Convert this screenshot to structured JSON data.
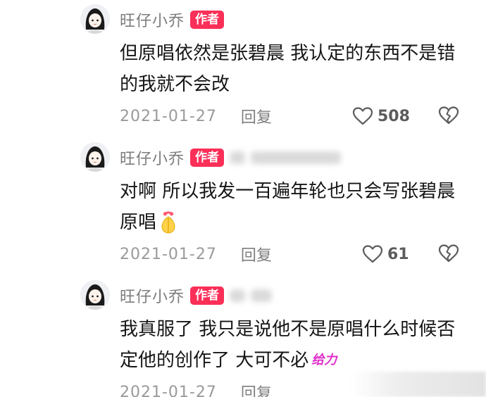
{
  "comments": [
    {
      "author": "旺仔小乔",
      "badge": "作者",
      "text": "但原唱依然是张碧晨 我认定的东西不是错的我就不会改",
      "date": "2021-01-27",
      "reply_label": "回复",
      "likes": "508"
    },
    {
      "author": "旺仔小乔",
      "badge": "作者",
      "text": "对啊 所以我发一百遍年轮也只会写张碧晨原唱",
      "date": "2021-01-27",
      "reply_label": "回复",
      "likes": "61"
    },
    {
      "author": "旺仔小乔",
      "badge": "作者",
      "text": "我真服了 我只是说他不是原唱什么时候否定他的创作了 大可不必",
      "sticker_text": "给力",
      "date": "2021-01-27",
      "reply_label": "回复"
    }
  ],
  "icons": {
    "like": "heart-outline-icon",
    "dislike": "broken-heart-icon",
    "emoji": "pray-hands-emoji"
  },
  "colors": {
    "badge": "#fb2f58",
    "sticker": "#e02cc9",
    "meta_text": "#9a9a9a"
  }
}
